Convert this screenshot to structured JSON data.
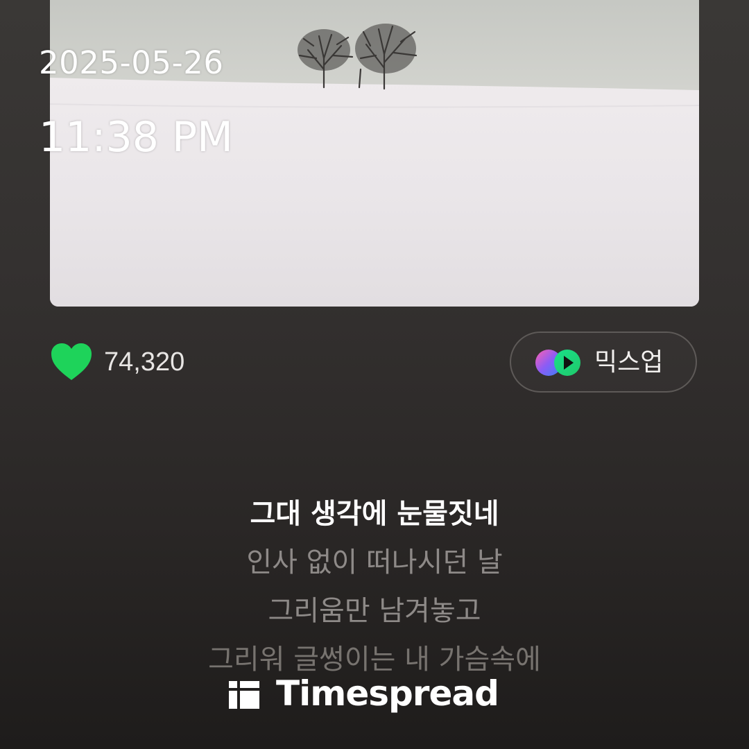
{
  "overlay": {
    "date": "2025-05-26",
    "time": "11:38 PM"
  },
  "album_art": {
    "description_icon": "album-cover-image"
  },
  "like": {
    "icon": "heart-icon",
    "count": "74,320",
    "color": "#1ed35a"
  },
  "mixup": {
    "icon": "mixup-icon",
    "label": "믹스업"
  },
  "lyrics": [
    {
      "text": "그대 생각에 눈물짓네",
      "current": true
    },
    {
      "text": "인사 없이 떠나시던 날",
      "current": false
    },
    {
      "text": "그리움만 남겨놓고",
      "current": false
    },
    {
      "text": "그리워 글썽이는 내 가슴속에",
      "current": false
    }
  ],
  "watermark": {
    "icon": "timespread-logo-icon",
    "text": "Timespread"
  },
  "colors": {
    "accent_green": "#1ed35a",
    "background": "#2f2c2b"
  }
}
